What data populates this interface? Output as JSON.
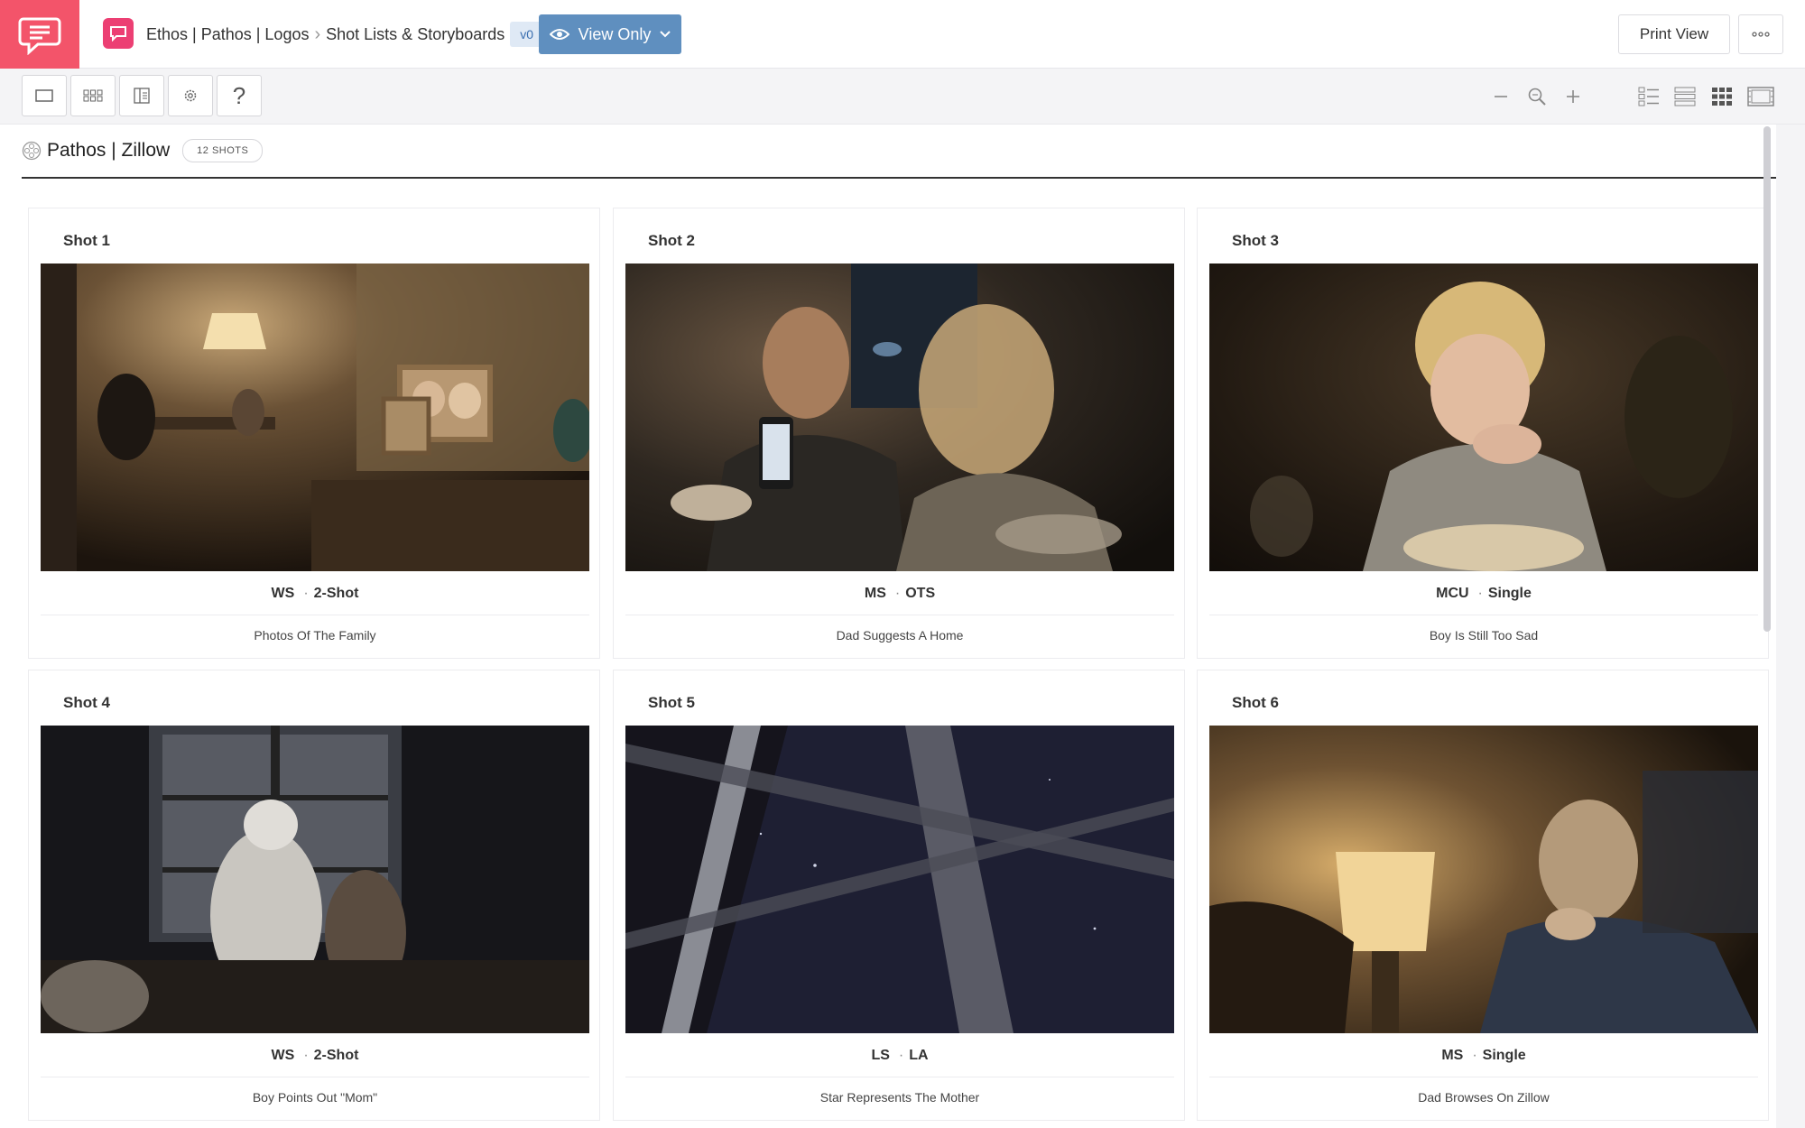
{
  "app": {
    "breadcrumb": {
      "project": "Ethos | Pathos | Logos",
      "section": "Shot Lists & Storyboards",
      "version": "v0"
    },
    "view_mode": "View Only",
    "print_label": "Print View",
    "brand_color": "#f3546a",
    "accent_color": "#5f8fbf"
  },
  "toolbar": {
    "left_buttons": [
      "frame-icon",
      "grid-icon",
      "panel-icon",
      "gear-icon",
      "help-icon"
    ],
    "help_label": "?",
    "zoom_controls": [
      "zoom-out-icon",
      "zoom-icon",
      "zoom-in-icon"
    ],
    "view_layouts": [
      "list-view-icon",
      "row-view-icon",
      "grid-view-icon",
      "film-view-icon"
    ]
  },
  "scene": {
    "title": "Pathos | Zillow",
    "shot_count": "12 SHOTS"
  },
  "shots": [
    {
      "label": "Shot 1",
      "size": "WS",
      "type": "2-Shot",
      "description": "Photos Of The Family"
    },
    {
      "label": "Shot 2",
      "size": "MS",
      "type": "OTS",
      "description": "Dad Suggests A Home"
    },
    {
      "label": "Shot 3",
      "size": "MCU",
      "type": "Single",
      "description": "Boy Is Still Too Sad"
    },
    {
      "label": "Shot 4",
      "size": "WS",
      "type": "2-Shot",
      "description": "Boy Points Out \"Mom\""
    },
    {
      "label": "Shot 5",
      "size": "LS",
      "type": "LA",
      "description": "Star Represents The Mother"
    },
    {
      "label": "Shot 6",
      "size": "MS",
      "type": "Single",
      "description": "Dad Browses On Zillow"
    }
  ]
}
